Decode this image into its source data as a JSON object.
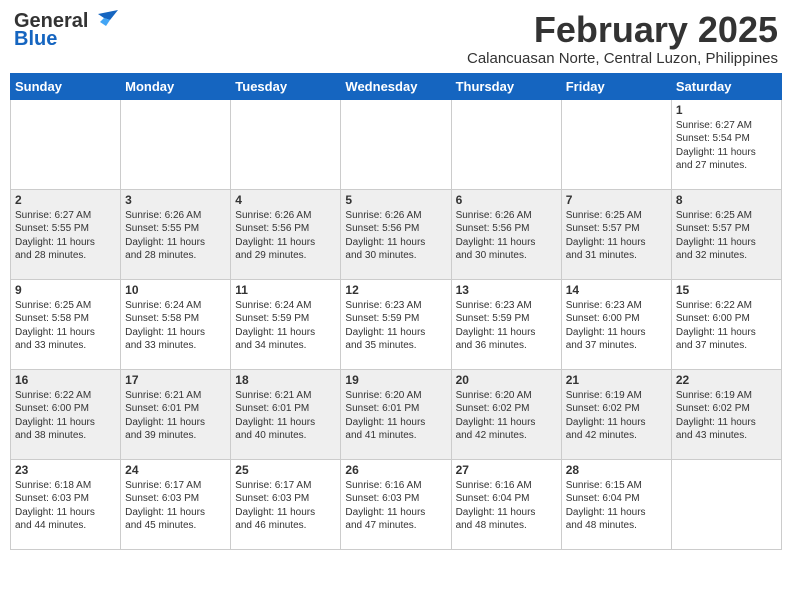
{
  "header": {
    "logo_line1": "General",
    "logo_line2": "Blue",
    "month_year": "February 2025",
    "location": "Calancuasan Norte, Central Luzon, Philippines"
  },
  "days_of_week": [
    "Sunday",
    "Monday",
    "Tuesday",
    "Wednesday",
    "Thursday",
    "Friday",
    "Saturday"
  ],
  "weeks": [
    [
      {
        "day": "",
        "info": ""
      },
      {
        "day": "",
        "info": ""
      },
      {
        "day": "",
        "info": ""
      },
      {
        "day": "",
        "info": ""
      },
      {
        "day": "",
        "info": ""
      },
      {
        "day": "",
        "info": ""
      },
      {
        "day": "1",
        "info": "Sunrise: 6:27 AM\nSunset: 5:54 PM\nDaylight: 11 hours\nand 27 minutes."
      }
    ],
    [
      {
        "day": "2",
        "info": "Sunrise: 6:27 AM\nSunset: 5:55 PM\nDaylight: 11 hours\nand 28 minutes."
      },
      {
        "day": "3",
        "info": "Sunrise: 6:26 AM\nSunset: 5:55 PM\nDaylight: 11 hours\nand 28 minutes."
      },
      {
        "day": "4",
        "info": "Sunrise: 6:26 AM\nSunset: 5:56 PM\nDaylight: 11 hours\nand 29 minutes."
      },
      {
        "day": "5",
        "info": "Sunrise: 6:26 AM\nSunset: 5:56 PM\nDaylight: 11 hours\nand 30 minutes."
      },
      {
        "day": "6",
        "info": "Sunrise: 6:26 AM\nSunset: 5:56 PM\nDaylight: 11 hours\nand 30 minutes."
      },
      {
        "day": "7",
        "info": "Sunrise: 6:25 AM\nSunset: 5:57 PM\nDaylight: 11 hours\nand 31 minutes."
      },
      {
        "day": "8",
        "info": "Sunrise: 6:25 AM\nSunset: 5:57 PM\nDaylight: 11 hours\nand 32 minutes."
      }
    ],
    [
      {
        "day": "9",
        "info": "Sunrise: 6:25 AM\nSunset: 5:58 PM\nDaylight: 11 hours\nand 33 minutes."
      },
      {
        "day": "10",
        "info": "Sunrise: 6:24 AM\nSunset: 5:58 PM\nDaylight: 11 hours\nand 33 minutes."
      },
      {
        "day": "11",
        "info": "Sunrise: 6:24 AM\nSunset: 5:59 PM\nDaylight: 11 hours\nand 34 minutes."
      },
      {
        "day": "12",
        "info": "Sunrise: 6:23 AM\nSunset: 5:59 PM\nDaylight: 11 hours\nand 35 minutes."
      },
      {
        "day": "13",
        "info": "Sunrise: 6:23 AM\nSunset: 5:59 PM\nDaylight: 11 hours\nand 36 minutes."
      },
      {
        "day": "14",
        "info": "Sunrise: 6:23 AM\nSunset: 6:00 PM\nDaylight: 11 hours\nand 37 minutes."
      },
      {
        "day": "15",
        "info": "Sunrise: 6:22 AM\nSunset: 6:00 PM\nDaylight: 11 hours\nand 37 minutes."
      }
    ],
    [
      {
        "day": "16",
        "info": "Sunrise: 6:22 AM\nSunset: 6:00 PM\nDaylight: 11 hours\nand 38 minutes."
      },
      {
        "day": "17",
        "info": "Sunrise: 6:21 AM\nSunset: 6:01 PM\nDaylight: 11 hours\nand 39 minutes."
      },
      {
        "day": "18",
        "info": "Sunrise: 6:21 AM\nSunset: 6:01 PM\nDaylight: 11 hours\nand 40 minutes."
      },
      {
        "day": "19",
        "info": "Sunrise: 6:20 AM\nSunset: 6:01 PM\nDaylight: 11 hours\nand 41 minutes."
      },
      {
        "day": "20",
        "info": "Sunrise: 6:20 AM\nSunset: 6:02 PM\nDaylight: 11 hours\nand 42 minutes."
      },
      {
        "day": "21",
        "info": "Sunrise: 6:19 AM\nSunset: 6:02 PM\nDaylight: 11 hours\nand 42 minutes."
      },
      {
        "day": "22",
        "info": "Sunrise: 6:19 AM\nSunset: 6:02 PM\nDaylight: 11 hours\nand 43 minutes."
      }
    ],
    [
      {
        "day": "23",
        "info": "Sunrise: 6:18 AM\nSunset: 6:03 PM\nDaylight: 11 hours\nand 44 minutes."
      },
      {
        "day": "24",
        "info": "Sunrise: 6:17 AM\nSunset: 6:03 PM\nDaylight: 11 hours\nand 45 minutes."
      },
      {
        "day": "25",
        "info": "Sunrise: 6:17 AM\nSunset: 6:03 PM\nDaylight: 11 hours\nand 46 minutes."
      },
      {
        "day": "26",
        "info": "Sunrise: 6:16 AM\nSunset: 6:03 PM\nDaylight: 11 hours\nand 47 minutes."
      },
      {
        "day": "27",
        "info": "Sunrise: 6:16 AM\nSunset: 6:04 PM\nDaylight: 11 hours\nand 48 minutes."
      },
      {
        "day": "28",
        "info": "Sunrise: 6:15 AM\nSunset: 6:04 PM\nDaylight: 11 hours\nand 48 minutes."
      },
      {
        "day": "",
        "info": ""
      }
    ]
  ]
}
